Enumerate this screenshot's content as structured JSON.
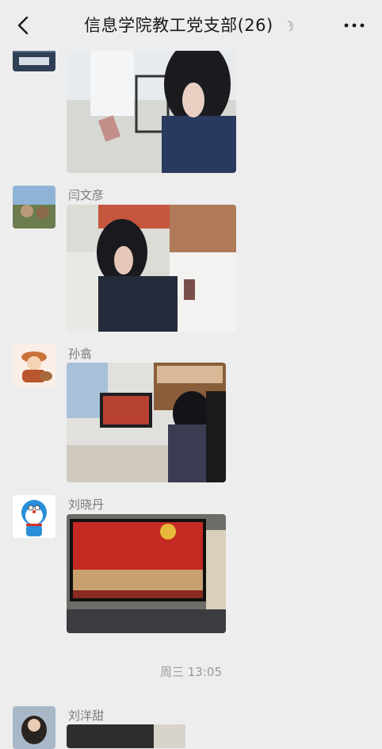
{
  "header": {
    "title": "信息学院教工党支部(26)"
  },
  "messages": [
    {
      "sender": ""
    },
    {
      "sender": "闫文彦"
    },
    {
      "sender": "孙翕"
    },
    {
      "sender": "刘晓丹"
    },
    {
      "sender": "刘洋甜"
    }
  ],
  "timestamp": "周三 13:05",
  "icons": [
    "back-icon",
    "mute-icon",
    "more-icon"
  ],
  "colors": {
    "background": "#ededed",
    "text": "#191919",
    "secondary": "#7a7a7a"
  }
}
